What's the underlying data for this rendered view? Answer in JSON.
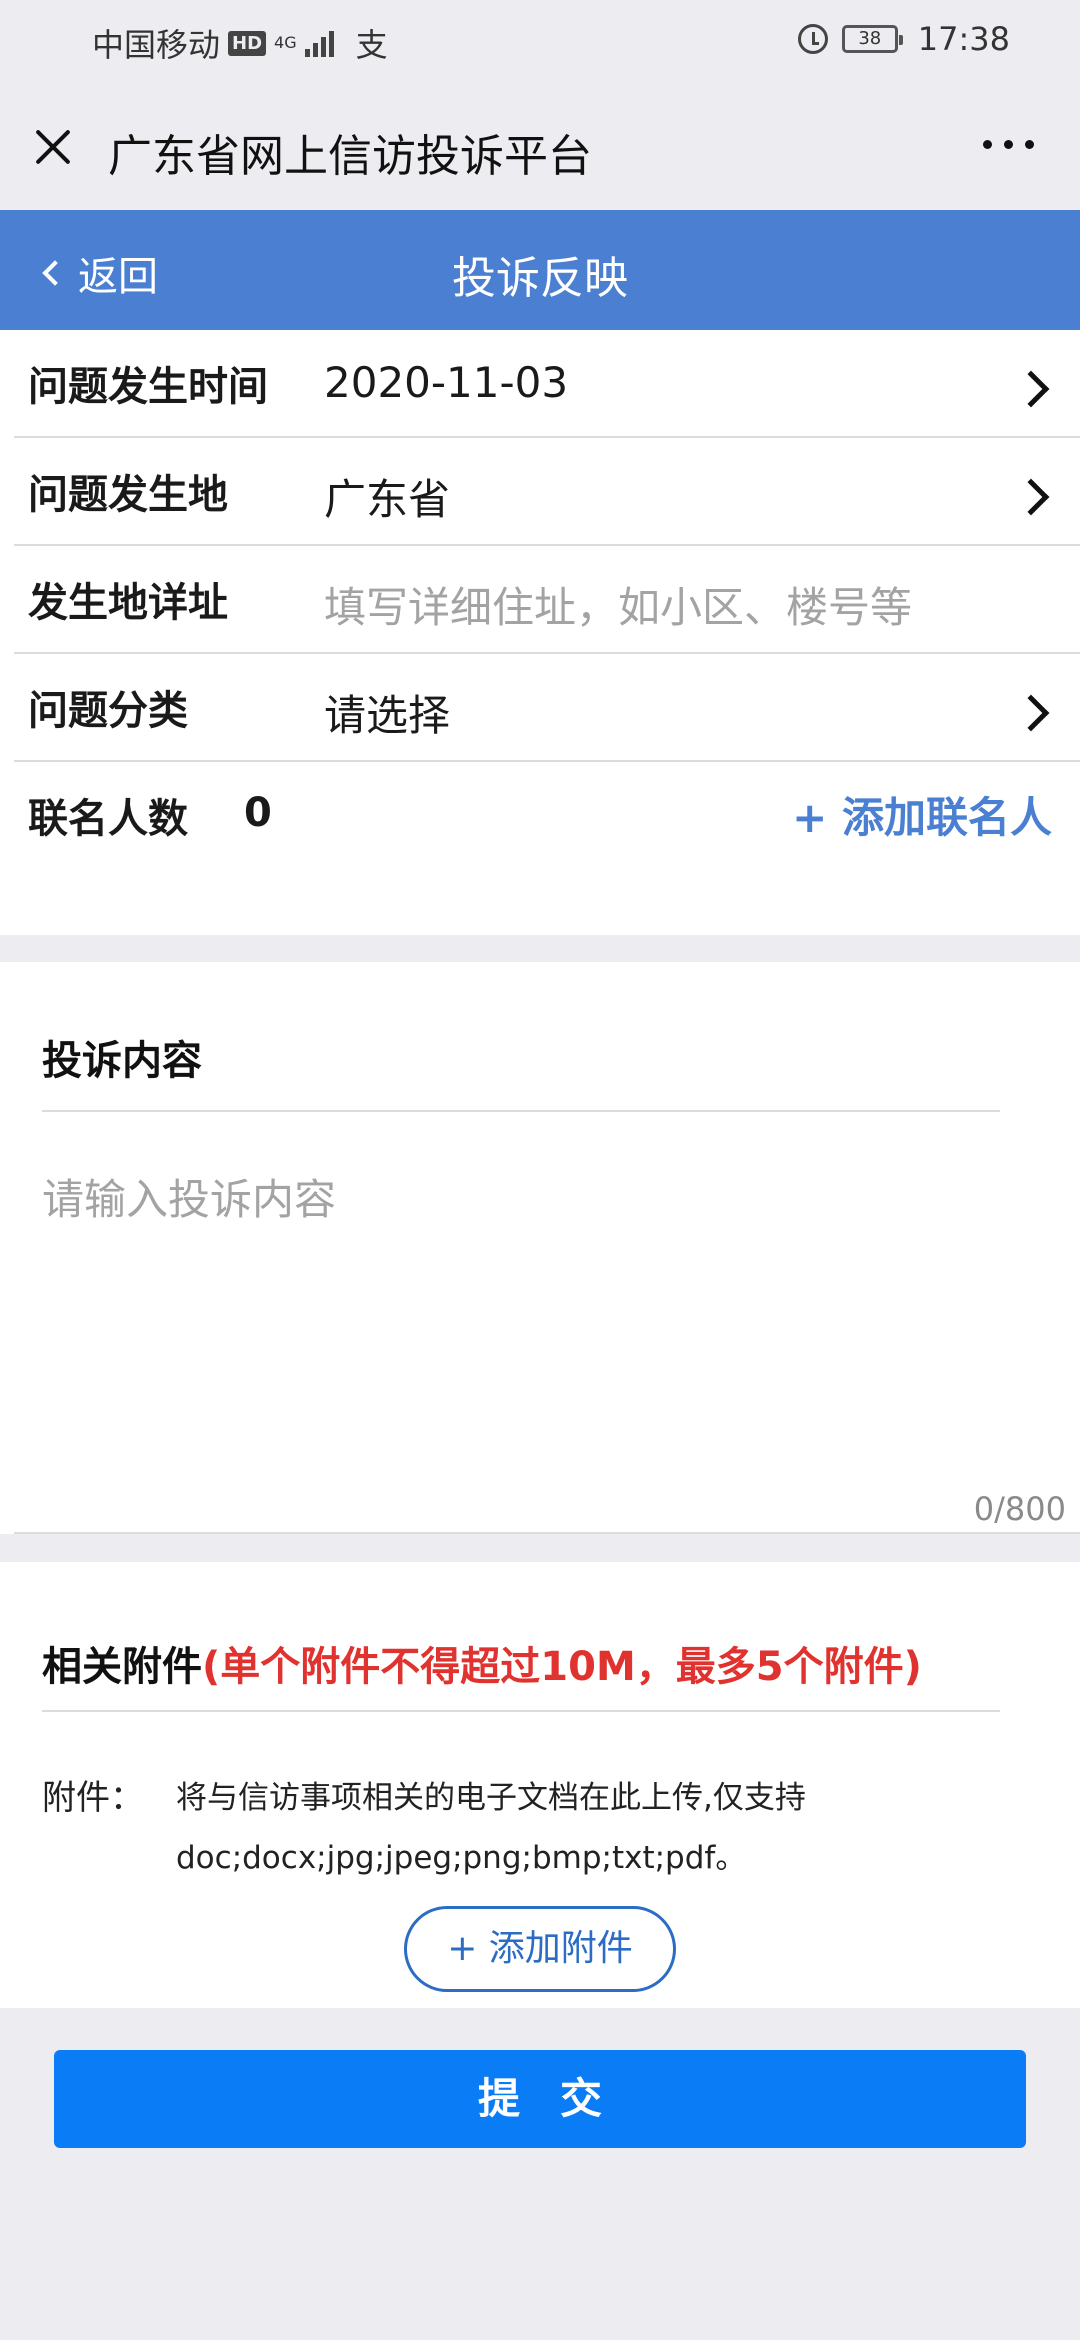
{
  "status_bar": {
    "carrier": "中国移动",
    "hd": "HD",
    "network": "4G",
    "pay_glyph": "支",
    "battery": "38",
    "time": "17:38"
  },
  "title_bar": {
    "title": "广东省网上信访投诉平台"
  },
  "nav": {
    "back_label": "返回",
    "title": "投诉反映"
  },
  "form": {
    "rows": [
      {
        "label": "问题发生时间",
        "value": "2020-11-03"
      },
      {
        "label": "问题发生地",
        "value": "广东省"
      },
      {
        "label": "发生地详址",
        "placeholder": "填写详细住址，如小区、楼号等"
      },
      {
        "label": "问题分类",
        "value": "请选择"
      }
    ],
    "cosign": {
      "label": "联名人数",
      "count": "0",
      "add_label": "+ 添加联名人"
    }
  },
  "content": {
    "title": "投诉内容",
    "placeholder": "请输入投诉内容",
    "char_count": "0/800"
  },
  "attachment": {
    "title": "相关附件",
    "note": "(单个附件不得超过10M，最多5个附件)",
    "label": "附件：",
    "description": "将与信访事项相关的电子文档在此上传,仅支持doc;docx;jpg;jpeg;png;bmp;txt;pdf。",
    "add_label": "+ 添加附件"
  },
  "submit_label": "提交",
  "colors": {
    "header_blue": "#4a7fd1",
    "submit_blue": "#0a7cf5",
    "warning_red": "#e0322e",
    "link_blue": "#4a7fd1"
  }
}
